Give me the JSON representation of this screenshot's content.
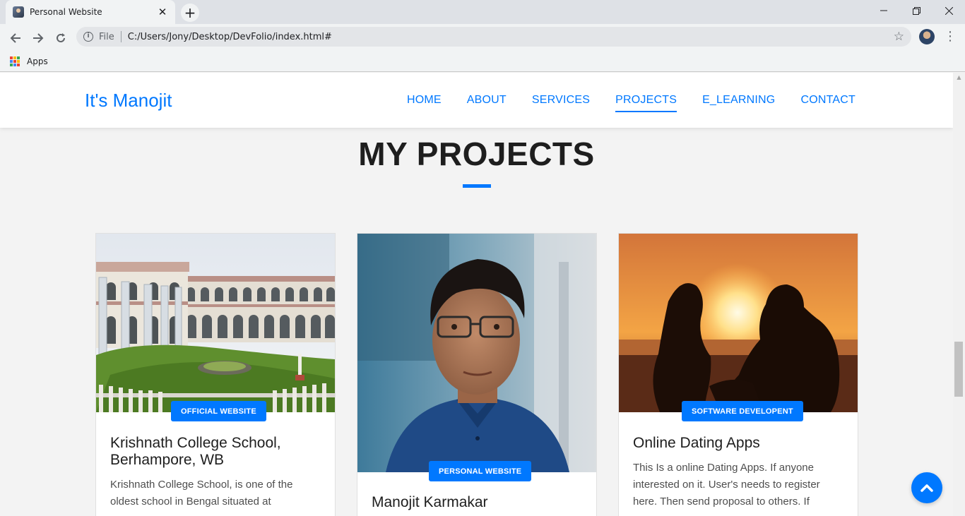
{
  "browser": {
    "tab_title": "Personal Website",
    "tab_close": "✕",
    "new_tab": "+",
    "window_controls": {
      "minimize": "—",
      "restore": "❐",
      "close": "✕"
    },
    "scheme_label": "File",
    "url": "C:/Users/Jony/Desktop/DevFolio/index.html#",
    "bookmarks": [
      {
        "label": "Apps"
      }
    ]
  },
  "site": {
    "brand": "It's Manojit",
    "nav": [
      {
        "label": "HOME"
      },
      {
        "label": "ABOUT"
      },
      {
        "label": "SERVICES"
      },
      {
        "label": "PROJECTS",
        "active": true
      },
      {
        "label": "E_LEARNING"
      },
      {
        "label": "CONTACT"
      }
    ],
    "section_title": "MY PROJECTS",
    "projects": [
      {
        "badge": "OFFICIAL WEBSITE",
        "title": "Krishnath College School, Berhampore, WB",
        "description": "Krishnath College School, is one of the oldest school in Bengal situated at",
        "image": "college-building-photo"
      },
      {
        "badge": "PERSONAL WEBSITE",
        "title": "Manojit Karmakar",
        "description": "",
        "image": "portrait-photo"
      },
      {
        "badge": "SOFTWARE DEVELOPENT",
        "title": "Online Dating Apps",
        "description": "This Is a online Dating Apps. If anyone interested on it. User's needs to register here. Then send proposal to others. If",
        "image": "sunset-couple-photo"
      }
    ]
  },
  "colors": {
    "accent": "#0078ff",
    "title": "#1e1e1e",
    "page_bg": "#f3f3f3"
  }
}
